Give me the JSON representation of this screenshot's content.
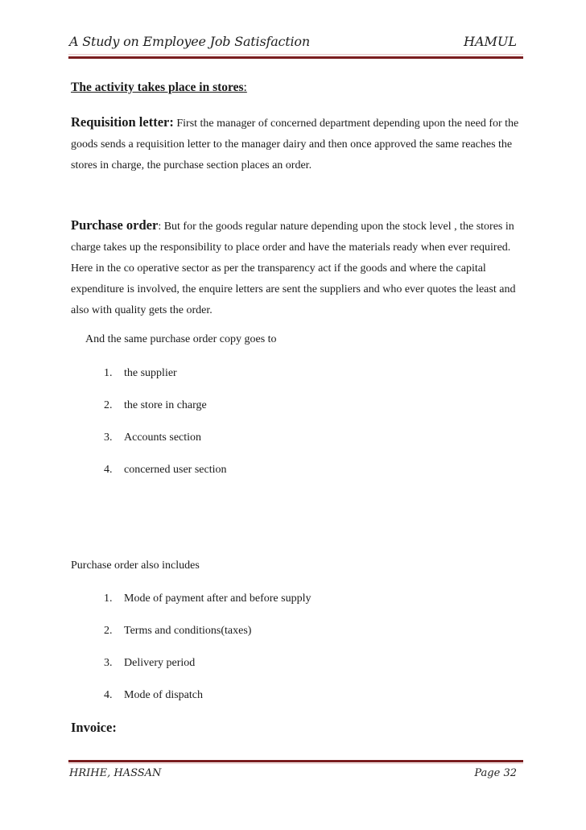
{
  "header": {
    "title": "A Study on Employee Job Satisfaction",
    "organization": "HAMUL",
    "rule_color": "#7a1d1f"
  },
  "body": {
    "section_heading": "The activity takes place in stores",
    "section_heading_suffix": ":",
    "requisition": {
      "lead": "Requisition letter:",
      "text": " First the manager of concerned department depending upon the need for the goods sends a requisition letter to the manager dairy and then once approved the same reaches the stores in charge, the purchase section places an order."
    },
    "purchase_order": {
      "lead": "Purchase order",
      "text": ": But for the goods regular nature depending upon the stock level , the stores in charge takes up the responsibility to place order and have the materials ready when ever required. Here in the co operative sector as per the transparency act if the goods and where the capital expenditure is involved, the enquire letters are sent the suppliers and who ever quotes the least and also with quality gets the order."
    },
    "copy_intro": "And the same purchase order copy goes to",
    "copy_recipients": [
      {
        "num": "1.",
        "text": "the supplier"
      },
      {
        "num": "2.",
        "text": "the store in charge"
      },
      {
        "num": "3.",
        "text": "Accounts section"
      },
      {
        "num": "4.",
        "text": "concerned user section"
      }
    ],
    "includes_intro": "Purchase order also includes",
    "includes": [
      {
        "num": "1.",
        "text": "Mode of payment after and before supply"
      },
      {
        "num": "2.",
        "text": "Terms and conditions(taxes)"
      },
      {
        "num": "3.",
        "text": "Delivery period"
      },
      {
        "num": "4.",
        "text": "Mode of dispatch"
      }
    ],
    "invoice_heading": "Invoice:"
  },
  "footer": {
    "author": "HRIHE, HASSAN",
    "page_label": "Page 32"
  }
}
